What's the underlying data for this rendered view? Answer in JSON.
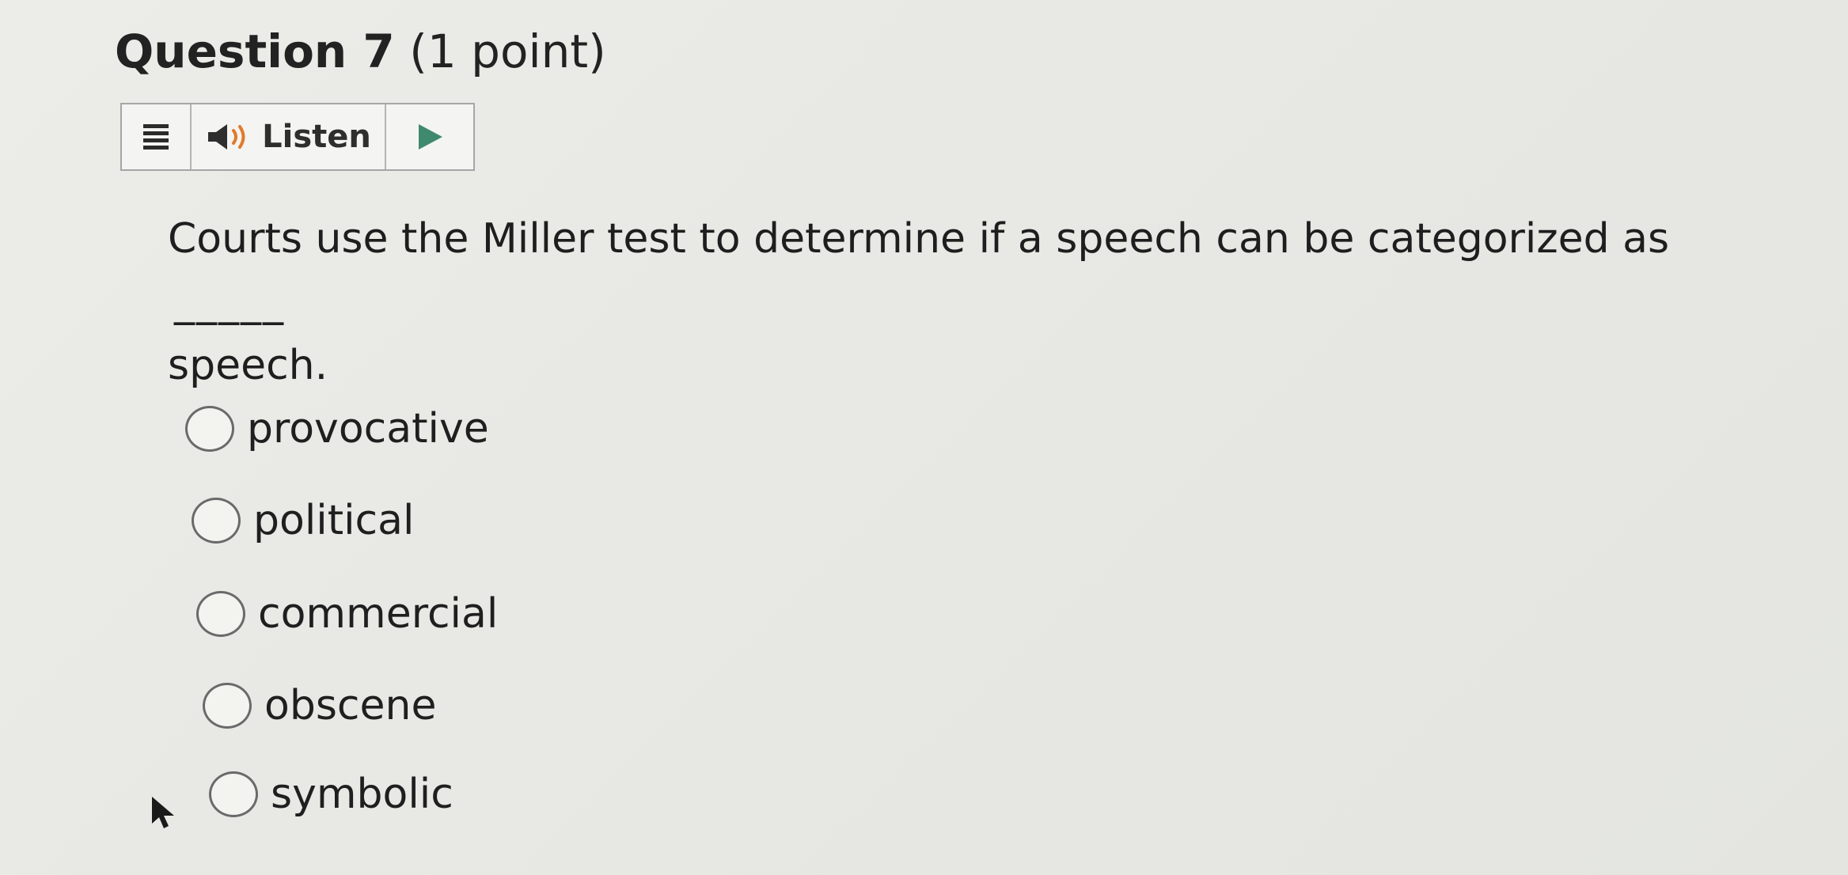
{
  "question": {
    "number_label": "Question 7",
    "points_label": "(1 point)"
  },
  "listen_toolbar": {
    "menu_icon": "menu-icon",
    "speaker_icon": "speaker-icon",
    "listen_label": "Listen",
    "play_icon": "play-icon"
  },
  "prompt": {
    "text": "Courts use the Miller test to determine if a speech can be categorized as",
    "blank": "_____",
    "text_after": "speech."
  },
  "options": [
    {
      "label": "provocative",
      "selected": false
    },
    {
      "label": "political",
      "selected": false
    },
    {
      "label": "commercial",
      "selected": false
    },
    {
      "label": "obscene",
      "selected": false
    },
    {
      "label": "symbolic",
      "selected": false
    }
  ],
  "colors": {
    "background": "#e9e9e5",
    "text": "#222222",
    "play_green": "#3f8a6e",
    "border": "#a6a6a6"
  }
}
